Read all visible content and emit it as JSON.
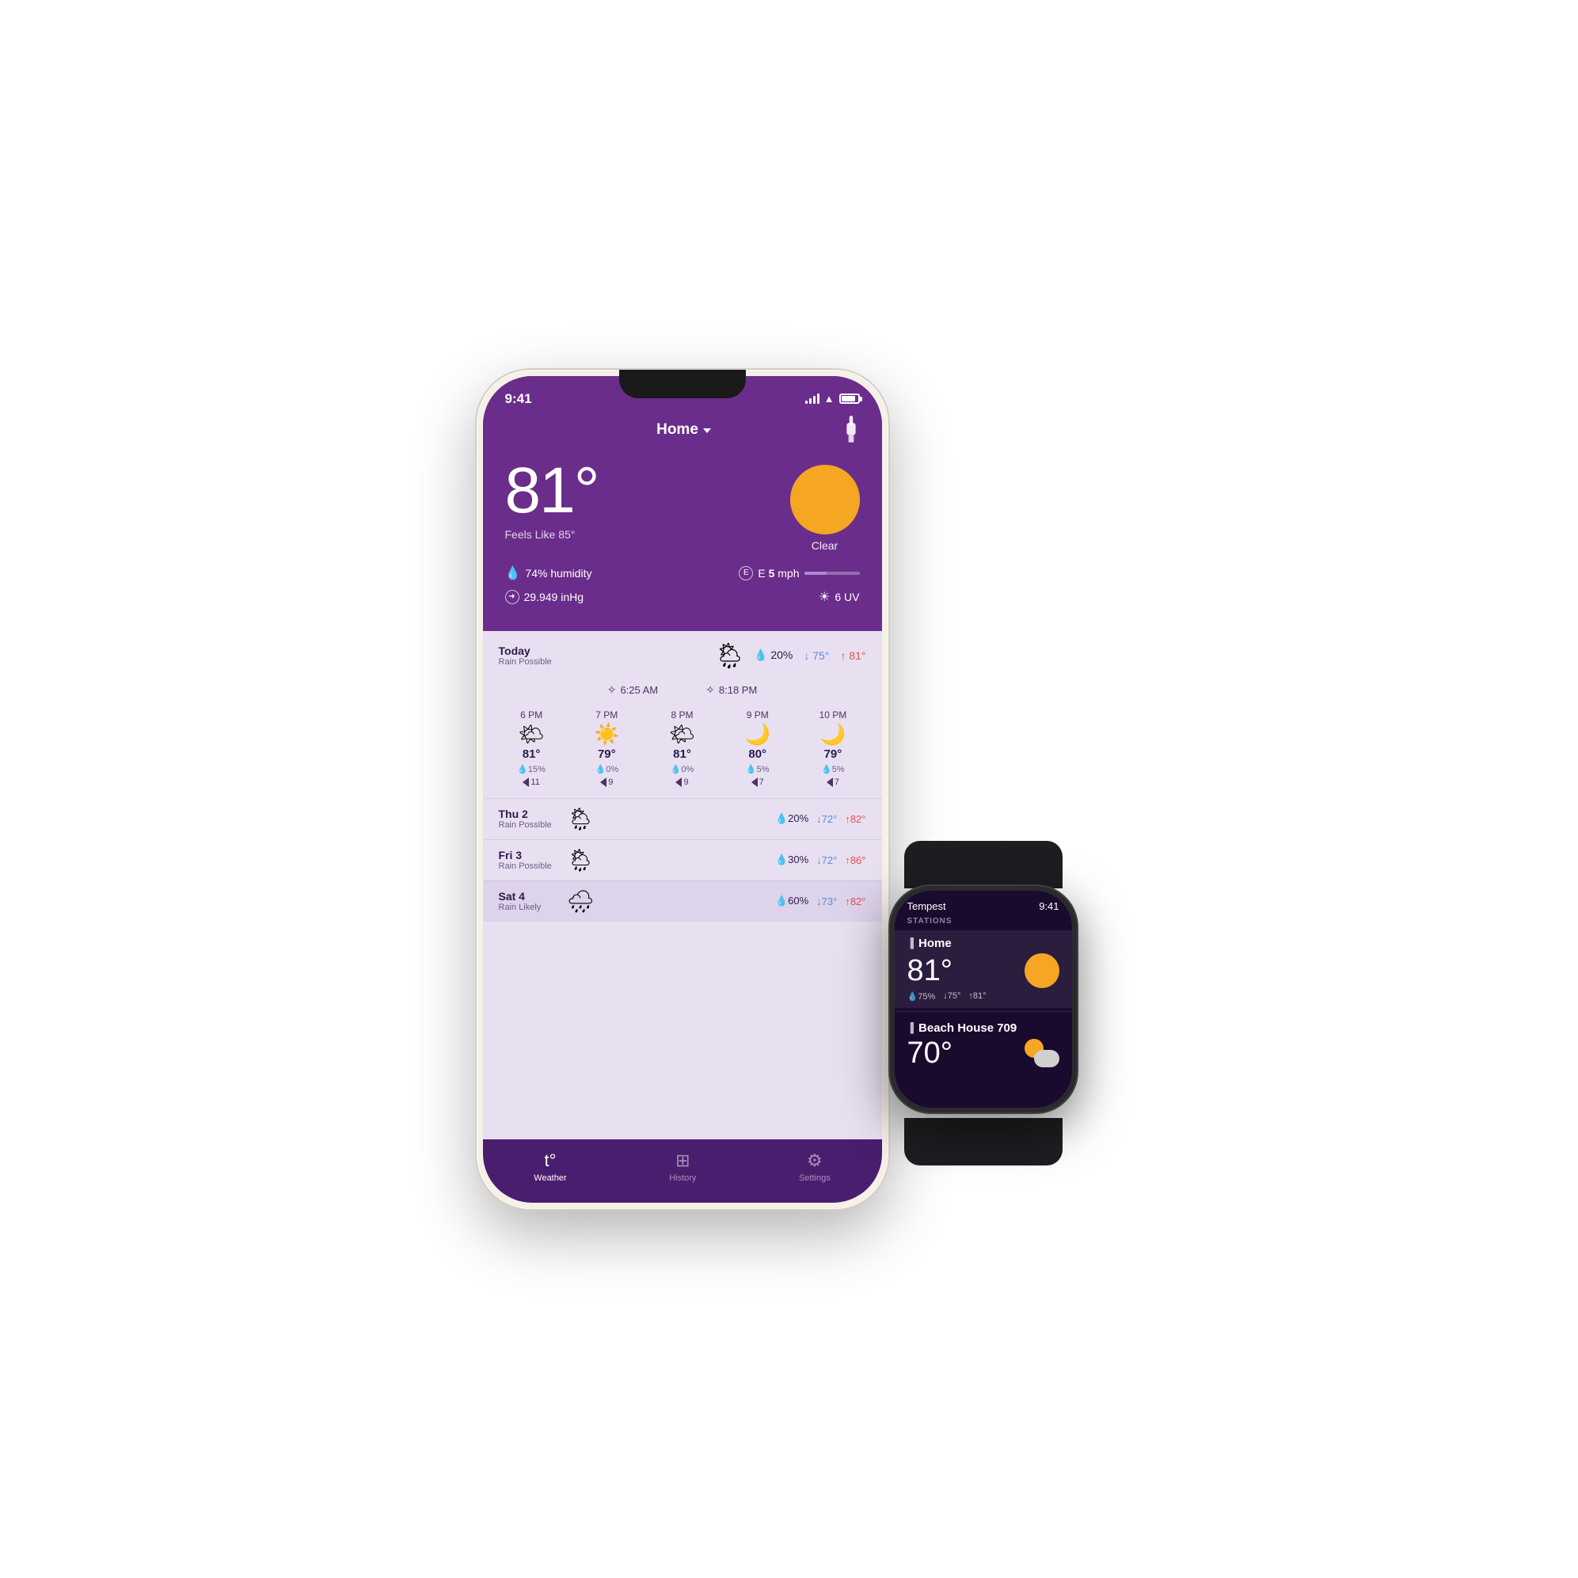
{
  "phone": {
    "status": {
      "time": "9:41",
      "battery_pct": 85
    },
    "header": {
      "title": "Home",
      "chevron": true
    },
    "current": {
      "temperature": "81°",
      "feels_like": "Feels Like 85°",
      "condition": "Clear",
      "humidity": "74% humidity",
      "wind_dir": "E",
      "wind_speed": "5",
      "wind_unit": "mph",
      "pressure": "29.949 inHg",
      "uv": "6 UV"
    },
    "today": {
      "label": "Today",
      "sub_label": "Rain Possible",
      "precip_pct": "20%",
      "low": "75°",
      "high": "81°",
      "sunrise": "6:25 AM",
      "sunset": "8:18 PM"
    },
    "hourly": [
      {
        "time": "6 PM",
        "icon": "sun",
        "temp": "81°",
        "precip": "15%",
        "wind": "11"
      },
      {
        "time": "7 PM",
        "icon": "sun",
        "temp": "79°",
        "precip": "0%",
        "wind": "9"
      },
      {
        "time": "8 PM",
        "icon": "sun",
        "temp": "81°",
        "precip": "0%",
        "wind": "9"
      },
      {
        "time": "9 PM",
        "icon": "moon",
        "temp": "80°",
        "precip": "5%",
        "wind": "7"
      },
      {
        "time": "10 PM",
        "icon": "moon",
        "temp": "79°",
        "precip": "5%",
        "wind": "7"
      }
    ],
    "daily": [
      {
        "day": "Thu 2",
        "sub": "Rain Possible",
        "precip": "20%",
        "low": "72°",
        "high": "82°",
        "icon": "partly_rain"
      },
      {
        "day": "Fri 3",
        "sub": "Rain Possible",
        "precip": "30%",
        "low": "72°",
        "high": "86°",
        "icon": "partly_rain"
      },
      {
        "day": "Sat 4",
        "sub": "Rain Likely",
        "precip": "60%",
        "low": "73°",
        "high": "82°",
        "icon": "rain"
      }
    ],
    "tabs": [
      {
        "id": "weather",
        "label": "Weather",
        "active": true
      },
      {
        "id": "history",
        "label": "History",
        "active": false
      },
      {
        "id": "settings",
        "label": "Settings",
        "active": false
      }
    ]
  },
  "watch": {
    "status": {
      "app_name": "Tempest",
      "time": "9:41"
    },
    "stations_label": "STATIONS",
    "stations": [
      {
        "name": "Home",
        "temp": "81°",
        "humidity": "75%",
        "low": "75°",
        "high": "81°",
        "icon": "sun",
        "active": true
      },
      {
        "name": "Beach House 709",
        "temp": "70°",
        "icon": "partly_cloudy",
        "active": false
      }
    ]
  }
}
